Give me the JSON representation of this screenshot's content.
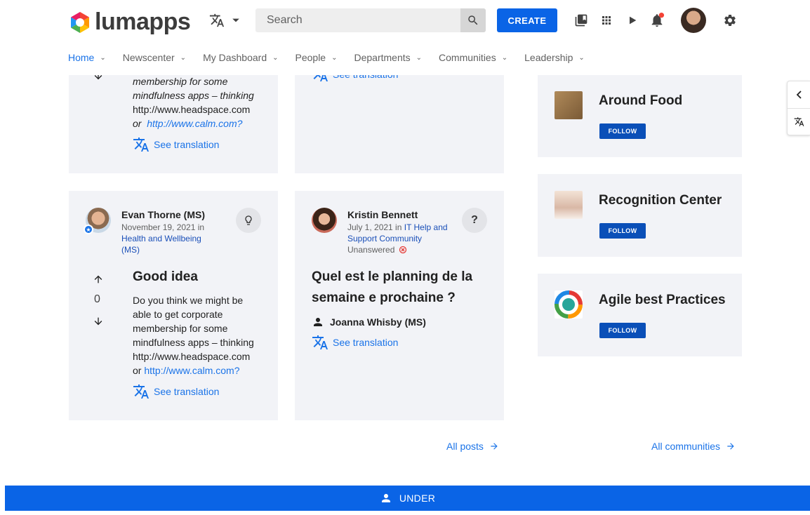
{
  "header": {
    "logo_text": "lumapps",
    "search_placeholder": "Search",
    "create_label": "CREATE",
    "icons": [
      "translate-icon",
      "caret-down-icon",
      "search-icon",
      "bookmarks-icon",
      "apps-grid-icon",
      "play-icon",
      "notifications-icon",
      "settings-icon"
    ],
    "notification_color": "#f44336"
  },
  "nav": {
    "items": [
      {
        "label": "Home",
        "active": true
      },
      {
        "label": "Newscenter"
      },
      {
        "label": "My Dashboard"
      },
      {
        "label": "People"
      },
      {
        "label": "Departments"
      },
      {
        "label": "Communities"
      },
      {
        "label": "Leadership"
      }
    ]
  },
  "top_card_left": {
    "text_1": "membership for some",
    "text_2": "mindfulness apps – thinking",
    "link_1": "http://www.headspace.com",
    "or": "or",
    "link_2": "http://www.calm.com?",
    "see_translation": "See translation"
  },
  "top_card_right": {
    "see_translation": "See translation"
  },
  "post_idea": {
    "author": "Evan Thorne (MS)",
    "date": "November 19, 2021 in",
    "community": "Health and Wellbeing (MS)",
    "title": "Good idea",
    "votes": "0",
    "text": "Do you think we might be able to get corporate membership for some mindfulness apps – thinking",
    "link_1": "http://www.headspace.com",
    "or": "or",
    "link_2": "http://www.calm.com?",
    "see_translation": "See translation"
  },
  "post_question": {
    "author": "Kristin Bennett",
    "date": "July 1, 2021 in",
    "community": "IT Help and Support Community",
    "status": "Unanswered",
    "title": "Quel est le planning de la semaine e prochaine ?",
    "mention": "Joanna Whisby (MS)",
    "see_translation": "See translation",
    "badge": "?"
  },
  "communities": [
    {
      "name": "Around Food",
      "follow": "FOLLOW"
    },
    {
      "name": "Recognition Center",
      "follow": "FOLLOW"
    },
    {
      "name": "Agile best Practices",
      "follow": "FOLLOW"
    }
  ],
  "links": {
    "all_posts": "All posts",
    "all_communities": "All communities"
  },
  "bottom_bar": {
    "label": "UNDER"
  },
  "colors": {
    "primary": "#0a64e6",
    "link": "#1a73e8",
    "card_bg": "#f2f3f7"
  }
}
